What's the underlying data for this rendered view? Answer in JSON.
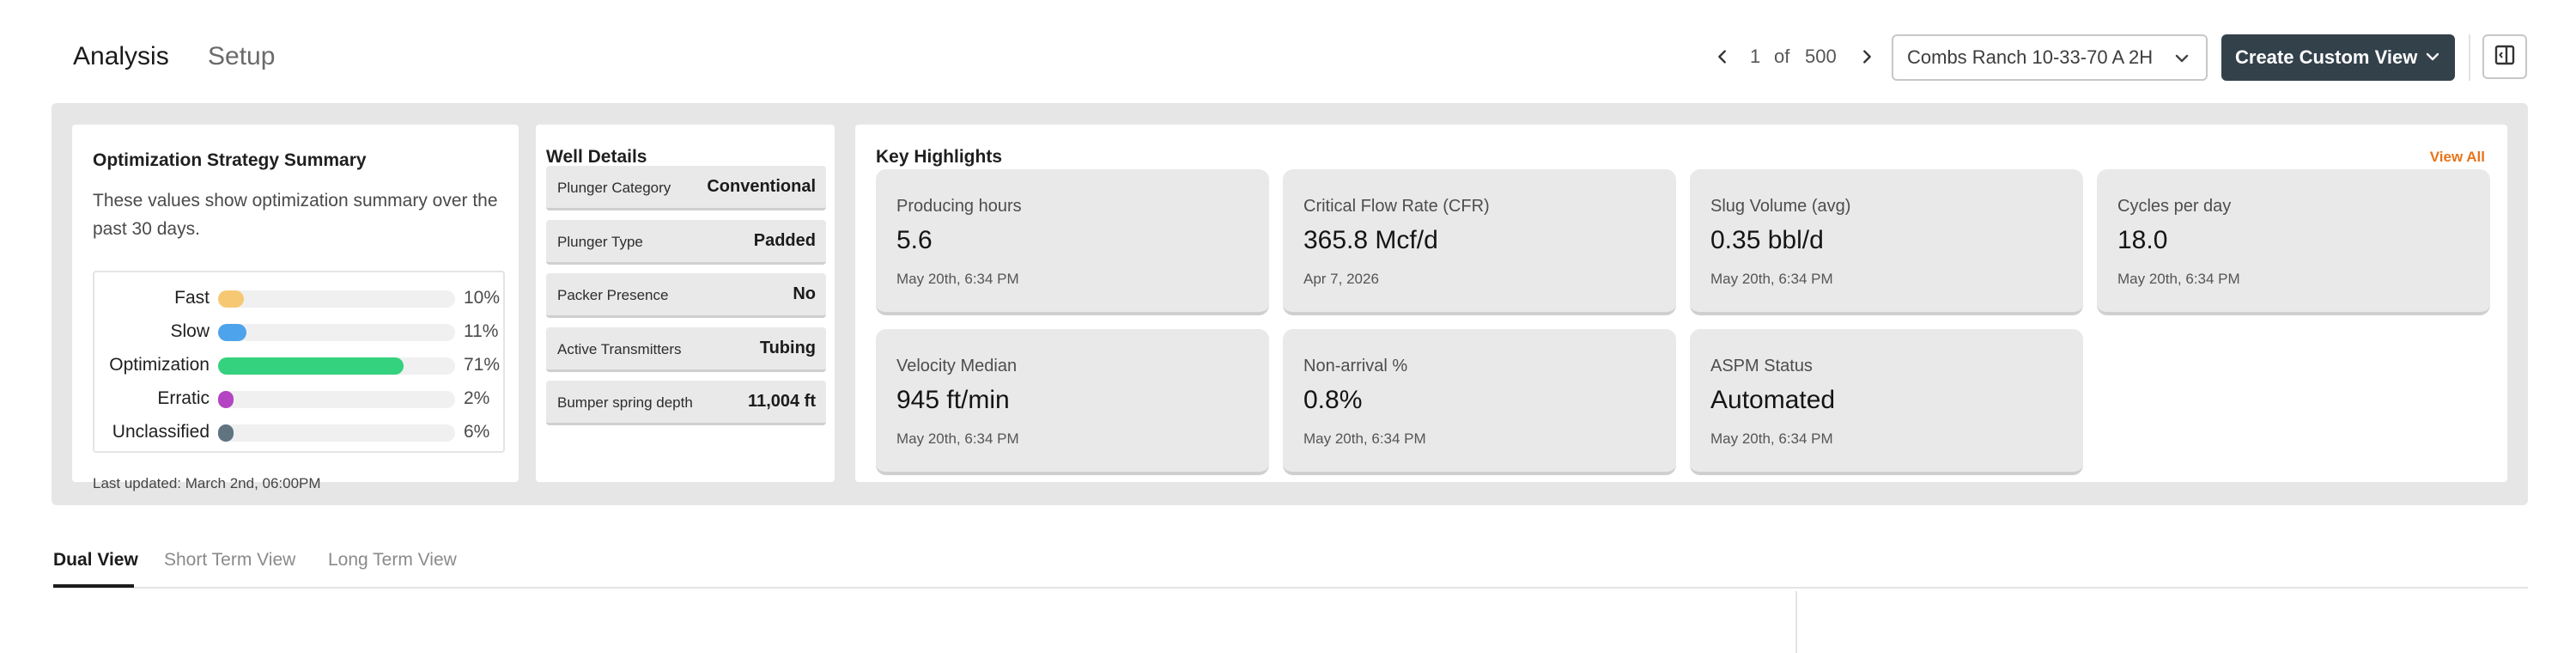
{
  "header": {
    "tabs": [
      {
        "label": "Analysis",
        "active": true
      },
      {
        "label": "Setup",
        "active": false
      }
    ],
    "pager": {
      "current": "1",
      "of_label": "of",
      "total": "500"
    },
    "well_select": {
      "value": "Combs Ranch 10-33-70 A 2H"
    },
    "create_button": {
      "label": "Create Custom View"
    },
    "icons": {
      "prev": "chevron-left-icon",
      "next": "chevron-right-icon",
      "select_caret": "chevron-down-icon",
      "create_caret": "chevron-down-icon",
      "panel": "panel-toggle-icon"
    }
  },
  "optimization": {
    "title": "Optimization Strategy Summary",
    "description": "These values show optimization summary over the past 30 days.",
    "rows": [
      {
        "label": "Fast",
        "percent": "10%",
        "fill_fraction": 0.1,
        "color": "#f7c873"
      },
      {
        "label": "Slow",
        "percent": "11%",
        "fill_fraction": 0.11,
        "color": "#4da3ec"
      },
      {
        "label": "Optimization",
        "percent": "71%",
        "fill_fraction": 0.71,
        "color": "#34d17e"
      },
      {
        "label": "Erratic",
        "percent": "2%",
        "fill_fraction": 0.02,
        "color": "#b345c2"
      },
      {
        "label": "Unclassified",
        "percent": "6%",
        "fill_fraction": 0.06,
        "color": "#5f7380"
      }
    ],
    "last_updated": "Last updated: March 2nd, 06:00PM"
  },
  "well_details": {
    "title": "Well Details",
    "rows": [
      {
        "key": "Plunger Category",
        "value": "Conventional"
      },
      {
        "key": "Plunger Type",
        "value": "Padded"
      },
      {
        "key": "Packer Presence",
        "value": "No"
      },
      {
        "key": "Active Transmitters",
        "value": "Tubing"
      },
      {
        "key": "Bumper spring depth",
        "value": "11,004 ft"
      }
    ]
  },
  "key_highlights": {
    "title": "Key Highlights",
    "view_all": "View All",
    "view_all_color": "#e8741b",
    "tiles": [
      {
        "label": "Producing hours",
        "value": "5.6",
        "timestamp": "May 20th, 6:34 PM"
      },
      {
        "label": "Critical Flow Rate (CFR)",
        "value": "365.8 Mcf/d",
        "timestamp": "Apr 7, 2026"
      },
      {
        "label": "Slug Volume (avg)",
        "value": "0.35 bbl/d",
        "timestamp": "May 20th, 6:34 PM"
      },
      {
        "label": "Cycles per day",
        "value": "18.0",
        "timestamp": "May 20th, 6:34 PM"
      },
      {
        "label": "Velocity Median",
        "value": "945 ft/min",
        "timestamp": "May 20th, 6:34 PM"
      },
      {
        "label": "Non-arrival %",
        "value": "0.8%",
        "timestamp": "May 20th, 6:34 PM"
      },
      {
        "label": "ASPM Status",
        "value": "Automated",
        "timestamp": "May 20th, 6:34 PM"
      }
    ]
  },
  "view_tabs": [
    {
      "label": "Dual View",
      "active": true
    },
    {
      "label": "Short Term View",
      "active": false
    },
    {
      "label": "Long Term View",
      "active": false
    }
  ]
}
